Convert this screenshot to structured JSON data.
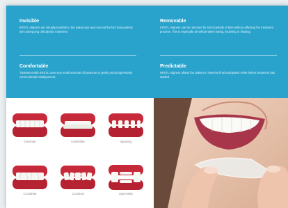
{
  "features": [
    {
      "title": "Invisible",
      "text": "KRSTL Aligners are virtually invisible to the naked eye and conceal the fact that patients are undergoing orthodontic treatment."
    },
    {
      "title": "Removable",
      "text": "KRSTL Aligners can be removed for short periods of time without affecting the treatment process. This is especially beneficial when eating, brushing or flossing."
    },
    {
      "title": "Comfortable",
      "text": "Treatment with KRSTL uses very small amounts of pressure to gently and progressively correct dental misalignment."
    },
    {
      "title": "Predictable",
      "text": "KRSTL Aligners allows the patient to view the final anticipated smile before treatment has started."
    }
  ],
  "conditions": [
    "Overbite",
    "Underbite",
    "Spacing",
    "Crossbite",
    "Crooked",
    "Open Bite"
  ],
  "colors": {
    "banner": "#2aa3cc",
    "gum": "#c62a3a",
    "tooth": "#f7f7f3"
  }
}
